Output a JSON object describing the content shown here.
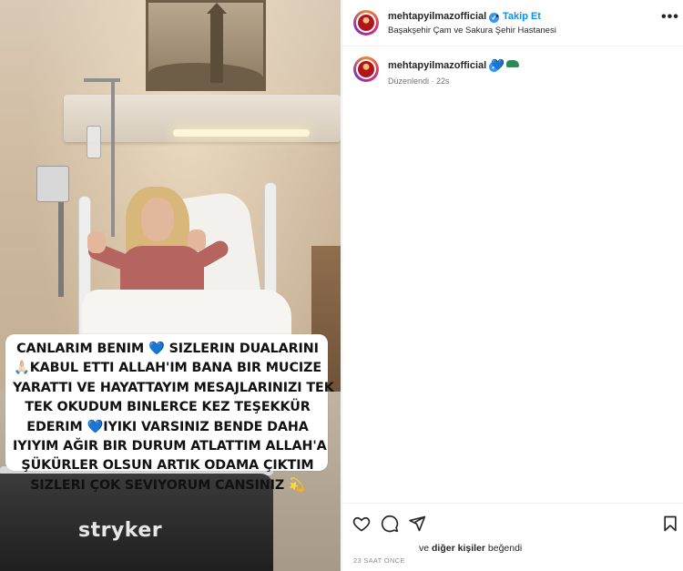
{
  "caption": {
    "lines": [
      [
        "CANLARIM BENIM ",
        "💙",
        " SIZLERIN DUALARINI"
      ],
      [
        "🙏🏻",
        "KABUL ETTI  ALLAH'IM BANA BIR MUCIZE"
      ],
      [
        "YARATTI VE HAYATTAYIM MESAJLARINIZI TEK"
      ],
      [
        "TEK OKUDUM BINLERCE KEZ TEŞEKKÜR"
      ],
      [
        "EDERIM ",
        "💙",
        "IYIKI VARSINIZ BENDE DAHA"
      ],
      [
        "IYIYIM AĞIR BIR DURUM ATLATTIM ALLAH'A"
      ],
      [
        "ŞÜKÜRLER OLSUN ARTIK ODAMA ÇIKTIM"
      ],
      [
        "SIZLERI ÇOK SEVIYORUM CANSINIZ ",
        "💫"
      ]
    ]
  },
  "photo": {
    "bed_brand": "stryker"
  },
  "header": {
    "username": "mehtapyilmazofficial",
    "separator": "•",
    "follow_label": "Takip Et",
    "location": "Başakşehir Çam ve Sakura Şehir Hastanesi",
    "more": "•••"
  },
  "comment": {
    "username": "mehtapyilmazofficial",
    "emoji": "💙",
    "edited": "Düzenlendi · 22s"
  },
  "likes": {
    "prefix": "ve ",
    "others": "diğer kişiler",
    "suffix": " beğendi"
  },
  "time_ago": "23 SAAT ÖNCE",
  "colors": {
    "link_blue": "#0095f6",
    "verified_blue": "#3897f0",
    "text": "#262626",
    "muted": "#737373"
  },
  "icons": [
    "like-icon",
    "comment-icon",
    "share-icon",
    "save-icon",
    "verified-icon",
    "more-options-icon"
  ]
}
